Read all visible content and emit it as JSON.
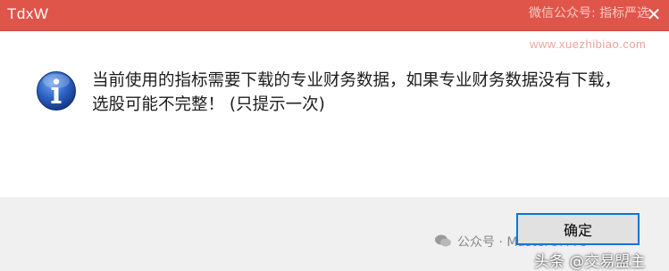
{
  "window": {
    "title": "TdxW",
    "close_glyph": "✕"
  },
  "watermarks": {
    "top": "微信公众号: 指标严选",
    "url": "www.xuezhibiao.com",
    "footer_account": "公众号 · MasterOfTTU",
    "footer_platform": "头条 @交易盟主"
  },
  "message": {
    "text": "当前使用的指标需要下载的专业财务数据，如果专业财务数据没有下载，选股可能不完整！ (只提示一次)",
    "icon": "info-icon"
  },
  "buttons": {
    "ok_label": "确定"
  },
  "colors": {
    "titlebar": "#e0554a",
    "icon_blue": "#2a5fc0",
    "focus_outline": "#0078d7"
  }
}
